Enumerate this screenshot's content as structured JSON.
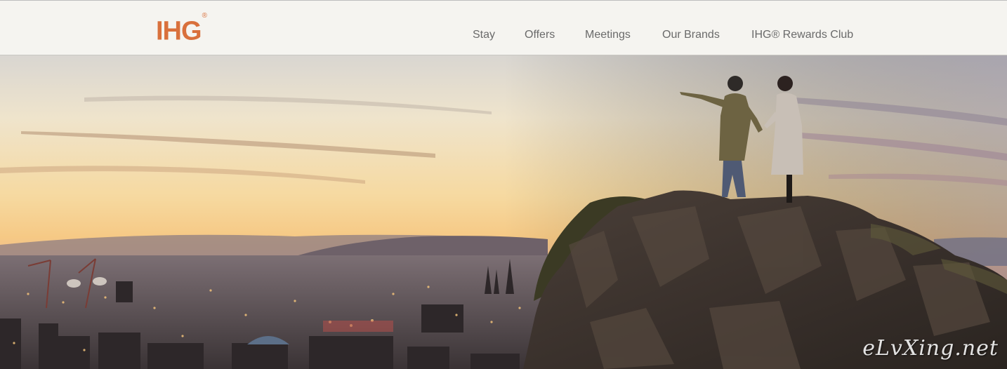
{
  "header": {
    "logo_text": "IHG",
    "logo_mark": "®",
    "nav": [
      {
        "label": "Stay"
      },
      {
        "label": "Offers"
      },
      {
        "label": "Meetings"
      },
      {
        "label": "Our Brands"
      },
      {
        "label": "IHG® Rewards Club"
      }
    ]
  },
  "hero": {
    "scene": "sunset-city-cliff-couple",
    "watermark": "eLvXing.net"
  },
  "colors": {
    "brand": "#d9703c",
    "nav_text": "#6a6a6a",
    "header_bg": "#f5f4f0"
  }
}
